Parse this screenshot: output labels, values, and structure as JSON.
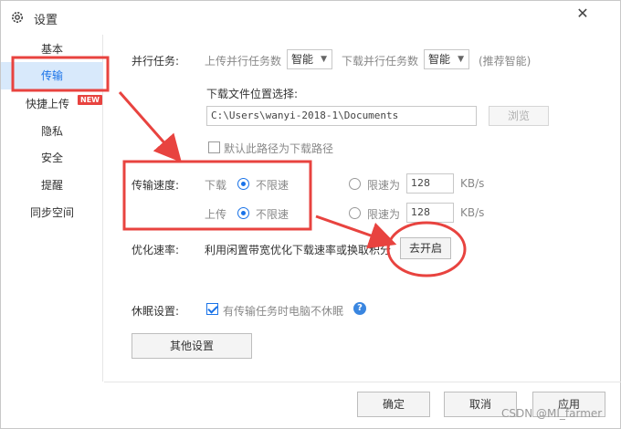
{
  "window": {
    "title": "设置",
    "settings_icon": "gear-icon",
    "close_icon": "close-icon",
    "close_glyph": "✕"
  },
  "sidebar": {
    "items": [
      {
        "label": "基本"
      },
      {
        "label": "传输"
      },
      {
        "label": "快捷上传",
        "badge": "NEW"
      },
      {
        "label": "隐私"
      },
      {
        "label": "安全"
      },
      {
        "label": "提醒"
      },
      {
        "label": "同步空间"
      }
    ],
    "active_index": 1
  },
  "parallel": {
    "label": "并行任务:",
    "upload_label": "上传并行任务数",
    "upload_value": "智能",
    "download_label": "下载并行任务数",
    "download_value": "智能",
    "hint": "(推荐智能)"
  },
  "download_location": {
    "label": "下载文件位置选择:",
    "path": "C:\\Users\\wanyi-2018-1\\Documents",
    "browse_button": "浏览",
    "default_checkbox_label": "默认此路径为下载路径",
    "default_checked": false
  },
  "speed": {
    "label": "传输速度:",
    "download_label": "下载",
    "upload_label": "上传",
    "unlimited_label": "不限速",
    "limit_label": "限速为",
    "download_limit_value": "128",
    "upload_limit_value": "128",
    "unit": "KB/s",
    "download_mode": "unlimited",
    "upload_mode": "unlimited"
  },
  "optimize": {
    "label": "优化速率:",
    "description": "利用闲置带宽优化下载速率或换取积分",
    "button": "去开启"
  },
  "sleep": {
    "label": "休眠设置:",
    "checkbox_label": "有传输任务时电脑不休眠",
    "checked": true,
    "help_icon": "help-icon",
    "help_glyph": "?"
  },
  "other_settings_button": "其他设置",
  "footer": {
    "ok": "确定",
    "cancel": "取消",
    "apply": "应用"
  },
  "watermark": "CSDN @MI_farmer",
  "annotation_color": "#e8433f",
  "accent_color": "#1a73e8"
}
